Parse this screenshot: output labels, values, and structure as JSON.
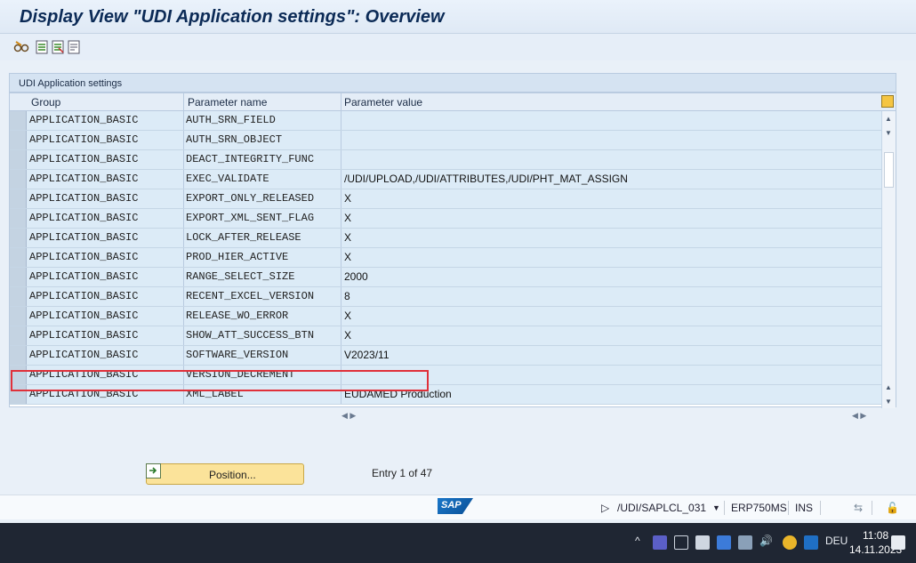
{
  "window": {
    "title": "Display View \"UDI Application settings\": Overview"
  },
  "toolbar": {
    "icons": [
      "glasses-edit-icon",
      "select-all-icon",
      "deselect-icon",
      "details-icon"
    ]
  },
  "panel": {
    "title": "UDI Application settings"
  },
  "table": {
    "headers": {
      "group": "Group",
      "param": "Parameter name",
      "value": "Parameter value"
    },
    "rows": [
      {
        "group": "APPLICATION_BASIC",
        "param": "AUTH_SRN_FIELD",
        "value": ""
      },
      {
        "group": "APPLICATION_BASIC",
        "param": "AUTH_SRN_OBJECT",
        "value": ""
      },
      {
        "group": "APPLICATION_BASIC",
        "param": "DEACT_INTEGRITY_FUNC",
        "value": ""
      },
      {
        "group": "APPLICATION_BASIC",
        "param": "EXEC_VALIDATE",
        "value": "/UDI/UPLOAD,/UDI/ATTRIBUTES,/UDI/PHT_MAT_ASSIGN"
      },
      {
        "group": "APPLICATION_BASIC",
        "param": "EXPORT_ONLY_RELEASED",
        "value": "X"
      },
      {
        "group": "APPLICATION_BASIC",
        "param": "EXPORT_XML_SENT_FLAG",
        "value": "X"
      },
      {
        "group": "APPLICATION_BASIC",
        "param": "LOCK_AFTER_RELEASE",
        "value": "X"
      },
      {
        "group": "APPLICATION_BASIC",
        "param": "PROD_HIER_ACTIVE",
        "value": "X"
      },
      {
        "group": "APPLICATION_BASIC",
        "param": "RANGE_SELECT_SIZE",
        "value": "2000"
      },
      {
        "group": "APPLICATION_BASIC",
        "param": "RECENT_EXCEL_VERSION",
        "value": "8"
      },
      {
        "group": "APPLICATION_BASIC",
        "param": "RELEASE_WO_ERROR",
        "value": "X"
      },
      {
        "group": "APPLICATION_BASIC",
        "param": "SHOW_ATT_SUCCESS_BTN",
        "value": "X"
      },
      {
        "group": "APPLICATION_BASIC",
        "param": "SOFTWARE_VERSION",
        "value": "V2023/11"
      },
      {
        "group": "APPLICATION_BASIC",
        "param": "VERSION_DECREMENT",
        "value": ""
      },
      {
        "group": "APPLICATION_BASIC",
        "param": "XML_LABEL",
        "value": "EUDAMED Production"
      }
    ]
  },
  "footer": {
    "position_label": "Position...",
    "entry_text": "Entry 1 of 47"
  },
  "statusbar": {
    "sap_logo": "SAP",
    "program": "/UDI/SAPLCL_031",
    "system": "ERP750MS",
    "mode": "INS"
  },
  "taskbar": {
    "language": "DEU",
    "time": "11:08",
    "date": "14.11.2023"
  },
  "colors": {
    "highlight": "#e0303a",
    "position_button": "#fbe39a"
  }
}
